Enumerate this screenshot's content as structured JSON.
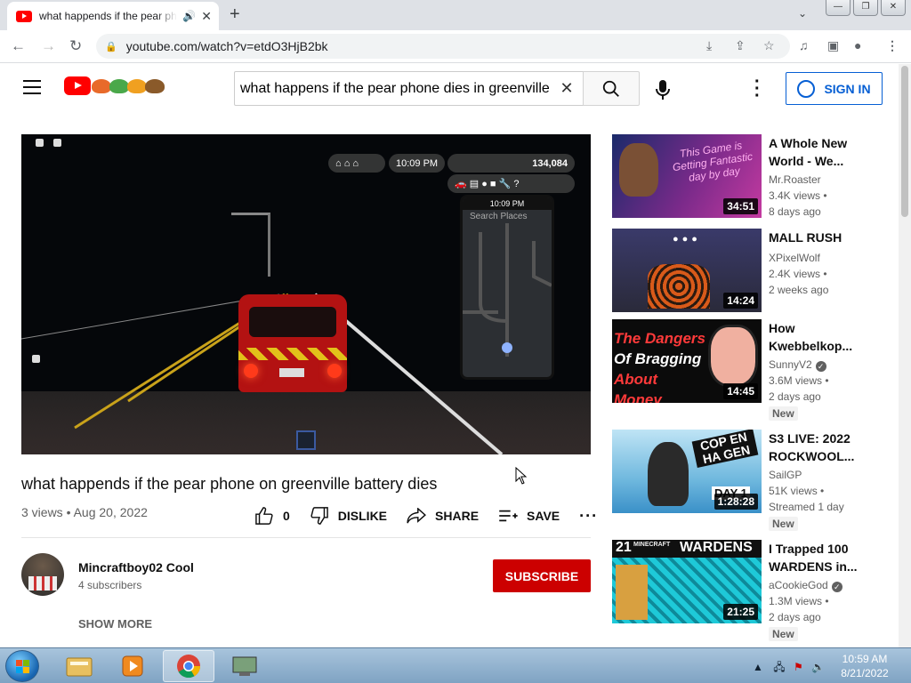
{
  "browser": {
    "tab_title": "what happends if the pear phone",
    "url": "youtube.com/watch?v=etdO3HjB2bk"
  },
  "header": {
    "search_query": "what happens if the pear phone dies in greenville",
    "sign_in": "SIGN IN"
  },
  "player": {
    "hud_time": "10:09 PM",
    "hud_money": "134,084",
    "phone_time": "10:09 PM",
    "phone_search": "Search Places",
    "plate": "MK-128"
  },
  "video": {
    "title": "what happends if the pear phone on greenville battery dies",
    "info": "3 views • Aug 20, 2022",
    "like_count": "0",
    "dislike": "DISLIKE",
    "share": "SHARE",
    "save": "SAVE"
  },
  "channel": {
    "name": "Mincraftboy02 Cool",
    "subs": "4 subscribers",
    "subscribe": "SUBSCRIBE",
    "show_more": "SHOW MORE"
  },
  "recs": [
    {
      "title": "A Whole New World - We...",
      "channel": "Mr.Roaster",
      "views": "3.4K views •",
      "date": "8 days ago",
      "duration": "34:51",
      "badge": "",
      "verified": false
    },
    {
      "title": "MALL RUSH",
      "channel": "XPixelWolf",
      "views": "2.4K views •",
      "date": "2 weeks ago",
      "duration": "14:24",
      "badge": "",
      "verified": false
    },
    {
      "title": "How Kwebbelkop...",
      "channel": "SunnyV2",
      "views": "3.6M views •",
      "date": "2 days ago",
      "duration": "14:45",
      "badge": "New",
      "verified": true
    },
    {
      "title": "S3 LIVE: 2022 ROCKWOOL...",
      "channel": "SailGP",
      "views": "51K views •",
      "date": "Streamed 1 day",
      "duration": "1:28:28",
      "badge": "New",
      "verified": false
    },
    {
      "title": "I Trapped 100 WARDENS in...",
      "channel": "aCookieGod",
      "views": "1.3M views •",
      "date": "2 days ago",
      "duration": "21:25",
      "badge": "New",
      "verified": true
    }
  ],
  "thumb_text": {
    "rec0": "This Game is Getting Fantastic day by day",
    "rec2_line1": "The Dangers",
    "rec2_line2": "Of Bragging",
    "rec2_line3": "About Money",
    "rec3": "COP EN HA GEN",
    "rec3_day": "DAY 1",
    "rec4_num": "21",
    "rec4_title": "WARDENS",
    "rec4_game": "MINECRAFT"
  },
  "taskbar": {
    "time": "10:59 AM",
    "date": "8/21/2022"
  },
  "colors": {
    "yt_red": "#ff0000",
    "link_blue": "#065fd4",
    "subscribe_red": "#cc0000"
  }
}
